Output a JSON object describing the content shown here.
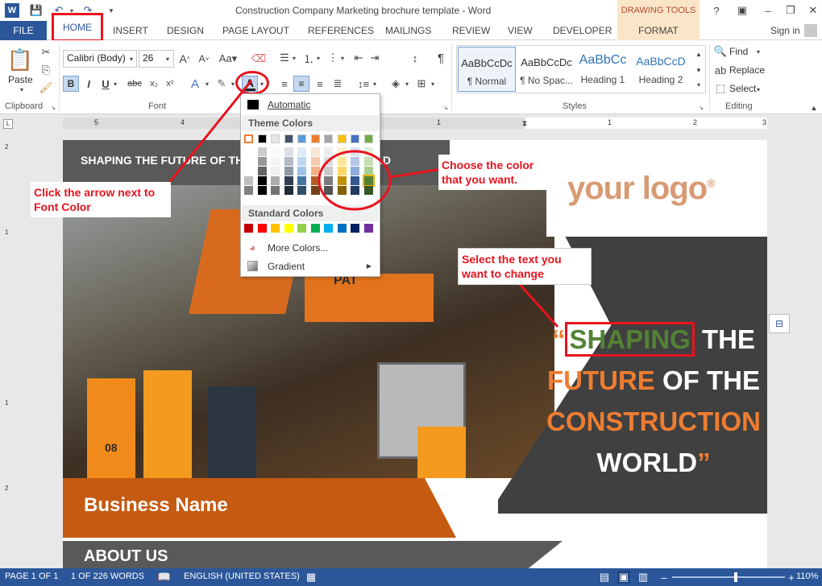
{
  "window": {
    "title": "Construction Company Marketing brochure template - Word"
  },
  "contextual": {
    "group": "DRAWING TOOLS",
    "tab": "FORMAT"
  },
  "tabs": [
    "FILE",
    "HOME",
    "INSERT",
    "DESIGN",
    "PAGE LAYOUT",
    "REFERENCES",
    "MAILINGS",
    "REVIEW",
    "VIEW",
    "DEVELOPER"
  ],
  "signin": "Sign in",
  "ribbon": {
    "clipboard": {
      "paste": "Paste",
      "label": "Clipboard"
    },
    "font": {
      "name": "Calibri (Body)",
      "size": "26",
      "label": "Font"
    },
    "paragraph": {
      "label": "Paragraph"
    },
    "styles": {
      "label": "Styles",
      "items": [
        {
          "preview": "AaBbCcDc",
          "name": "¶ Normal"
        },
        {
          "preview": "AaBbCcDc",
          "name": "¶ No Spac..."
        },
        {
          "preview": "AaBbCc",
          "name": "Heading 1"
        },
        {
          "preview": "AaBbCcD",
          "name": "Heading 2"
        }
      ]
    },
    "editing": {
      "find": "Find",
      "replace": "Replace",
      "select": "Select",
      "label": "Editing"
    }
  },
  "colorMenu": {
    "automatic": "Automatic",
    "theme_header": "Theme Colors",
    "standard_header": "Standard Colors",
    "more": "More Colors...",
    "gradient": "Gradient",
    "theme_top": [
      "#ffffff",
      "#000000",
      "#e7e6e6",
      "#44546a",
      "#5b9bd5",
      "#ed7d31",
      "#a5a5a5",
      "#ffc000",
      "#4472c4",
      "#70ad47"
    ],
    "standard": [
      "#c00000",
      "#ff0000",
      "#ffc000",
      "#ffff00",
      "#92d050",
      "#00b050",
      "#00b0f0",
      "#0070c0",
      "#002060",
      "#7030a0"
    ]
  },
  "ruler": {
    "marks": [
      "5",
      "4",
      "3",
      "2",
      "1",
      "1",
      "2",
      "3"
    ],
    "vmarks": [
      "2",
      "1",
      "1",
      "2"
    ]
  },
  "doc": {
    "banner": "SHAPING THE FUTURE OF THE CONSTRUCTION WORLD",
    "logo": "your logo",
    "logo_mark": "®",
    "headline": {
      "open_quote": "“",
      "w1": "SHAPING",
      "w2": " THE",
      "w3": "FUTURE",
      "w4": " OF THE",
      "w5": "CONSTRUCTION",
      "w6": "WORLD",
      "close_quote": "”"
    },
    "business": "Business Name",
    "about": "ABOUT US",
    "photo_marks": {
      "pat": "PAT",
      "num": "08"
    }
  },
  "callouts": {
    "font_color": "Click the arrow next to Font Color",
    "choose": "Choose the color that you want.",
    "select": "Select the text you want to change"
  },
  "status": {
    "page": "PAGE 1 OF 1",
    "words": "1 OF 226 WORDS",
    "lang": "ENGLISH (UNITED STATES)",
    "zoom": "110%"
  },
  "colors": {
    "accent": "#2b579a",
    "orange": "#ee7d31",
    "green": "#548235",
    "callout": "#e8131e",
    "dark": "#404040"
  }
}
